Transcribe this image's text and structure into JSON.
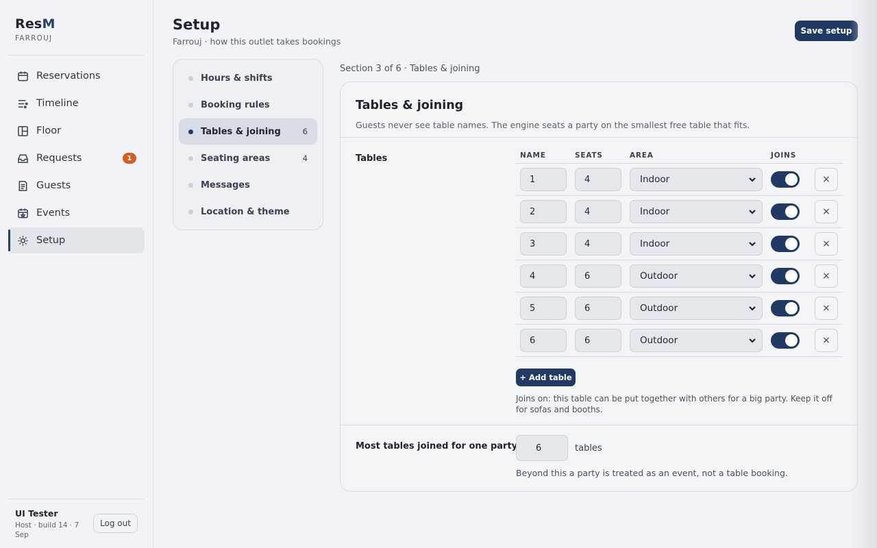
{
  "app": {
    "brand_part1": "Res",
    "brand_part2": "M",
    "outlet": "FARROUJ"
  },
  "sidebar": {
    "items": [
      {
        "label": "Reservations",
        "icon": "calendar-icon"
      },
      {
        "label": "Timeline",
        "icon": "timeline-icon"
      },
      {
        "label": "Floor",
        "icon": "floor-plan-icon"
      },
      {
        "label": "Requests",
        "icon": "inbox-icon",
        "badge": "1"
      },
      {
        "label": "Guests",
        "icon": "guest-list-icon"
      },
      {
        "label": "Events",
        "icon": "event-calendar-icon"
      },
      {
        "label": "Setup",
        "icon": "gear-icon",
        "active": true
      }
    ],
    "user": {
      "name": "UI Tester",
      "meta": "Host · build 14 · 7 Sep",
      "logout": "Log out"
    }
  },
  "header": {
    "title": "Setup",
    "subtitle": "Farrouj · how this outlet takes bookings",
    "save_label": "Save setup"
  },
  "sections": [
    {
      "label": "Hours & shifts",
      "count": ""
    },
    {
      "label": "Booking rules",
      "count": ""
    },
    {
      "label": "Tables & joining",
      "count": "6",
      "active": true
    },
    {
      "label": "Seating areas",
      "count": "4"
    },
    {
      "label": "Messages",
      "count": ""
    },
    {
      "label": "Location & theme",
      "count": ""
    }
  ],
  "main": {
    "crumb": "Section 3 of 6 · Tables & joining",
    "title": "Tables & joining",
    "description": "Guests never see table names. The engine seats a party on the smallest free table that fits.",
    "tables_label": "Tables",
    "columns": {
      "name": "NAME",
      "seats": "SEATS",
      "area": "AREA",
      "joins": "JOINS"
    },
    "tables": [
      {
        "name": "1",
        "seats": "4",
        "area": "Indoor",
        "joins": true
      },
      {
        "name": "2",
        "seats": "4",
        "area": "Indoor",
        "joins": true
      },
      {
        "name": "3",
        "seats": "4",
        "area": "Indoor",
        "joins": true
      },
      {
        "name": "4",
        "seats": "6",
        "area": "Outdoor",
        "joins": true
      },
      {
        "name": "5",
        "seats": "6",
        "area": "Outdoor",
        "joins": true
      },
      {
        "name": "6",
        "seats": "6",
        "area": "Outdoor",
        "joins": true
      }
    ],
    "remove_glyph": "×",
    "add_table_label": "+ Add table",
    "joins_note": "Joins on: this table can be put together with others for a big party. Keep it off for sofas and booths.",
    "max_join": {
      "label": "Most tables joined for one party",
      "value": "6",
      "unit": "tables",
      "note": "Beyond this a party is treated as an event, not a table booking."
    }
  },
  "colors": {
    "primary": "#213a63",
    "badge": "#d75b1f",
    "background": "#f1f3f6"
  }
}
